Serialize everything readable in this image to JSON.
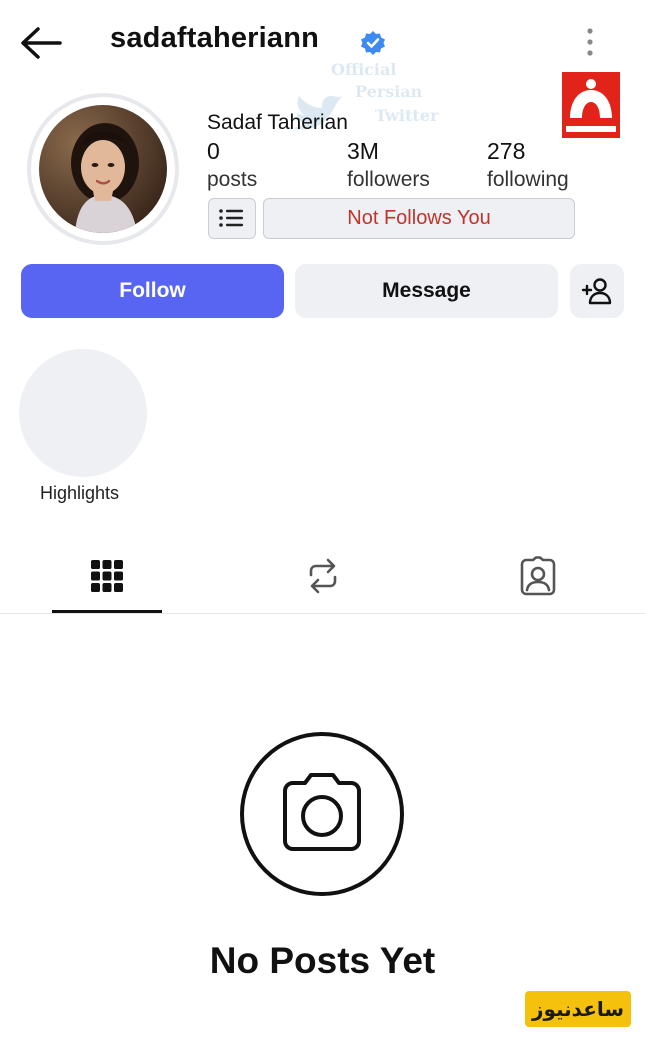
{
  "header": {
    "username": "sadaftaheriann",
    "back_icon": "arrow-left-icon",
    "verified_icon": "verified-badge-icon",
    "more_icon": "more-vertical-icon"
  },
  "watermark": {
    "line1": "Official",
    "line2": "Persian",
    "line3": "Twitter"
  },
  "profile": {
    "display_name": "Sadaf Taherian",
    "stats": {
      "posts_count": "0",
      "posts_label": "posts",
      "followers_count": "3M",
      "followers_label": "followers",
      "following_count": "278",
      "following_label": "following"
    },
    "follow_status": "Not Follows You",
    "list_icon": "list-icon"
  },
  "actions": {
    "follow_label": "Follow",
    "message_label": "Message",
    "add_user_icon": "add-user-icon"
  },
  "highlights": {
    "label": "Highlights"
  },
  "tabs": [
    {
      "icon": "grid-icon",
      "active": true
    },
    {
      "icon": "repost-icon",
      "active": false
    },
    {
      "icon": "tagged-icon",
      "active": false
    }
  ],
  "empty_state": {
    "icon": "camera-icon",
    "title": "No Posts Yet"
  },
  "site_badge": {
    "text": "ساعدنیوز"
  },
  "colors": {
    "accent": "#5865f2",
    "status_text": "#c0352b",
    "button_bg": "#eef0f4",
    "verified": "#3d8bf2",
    "news_red": "#e2231a",
    "badge_yellow": "#f4c20d"
  }
}
